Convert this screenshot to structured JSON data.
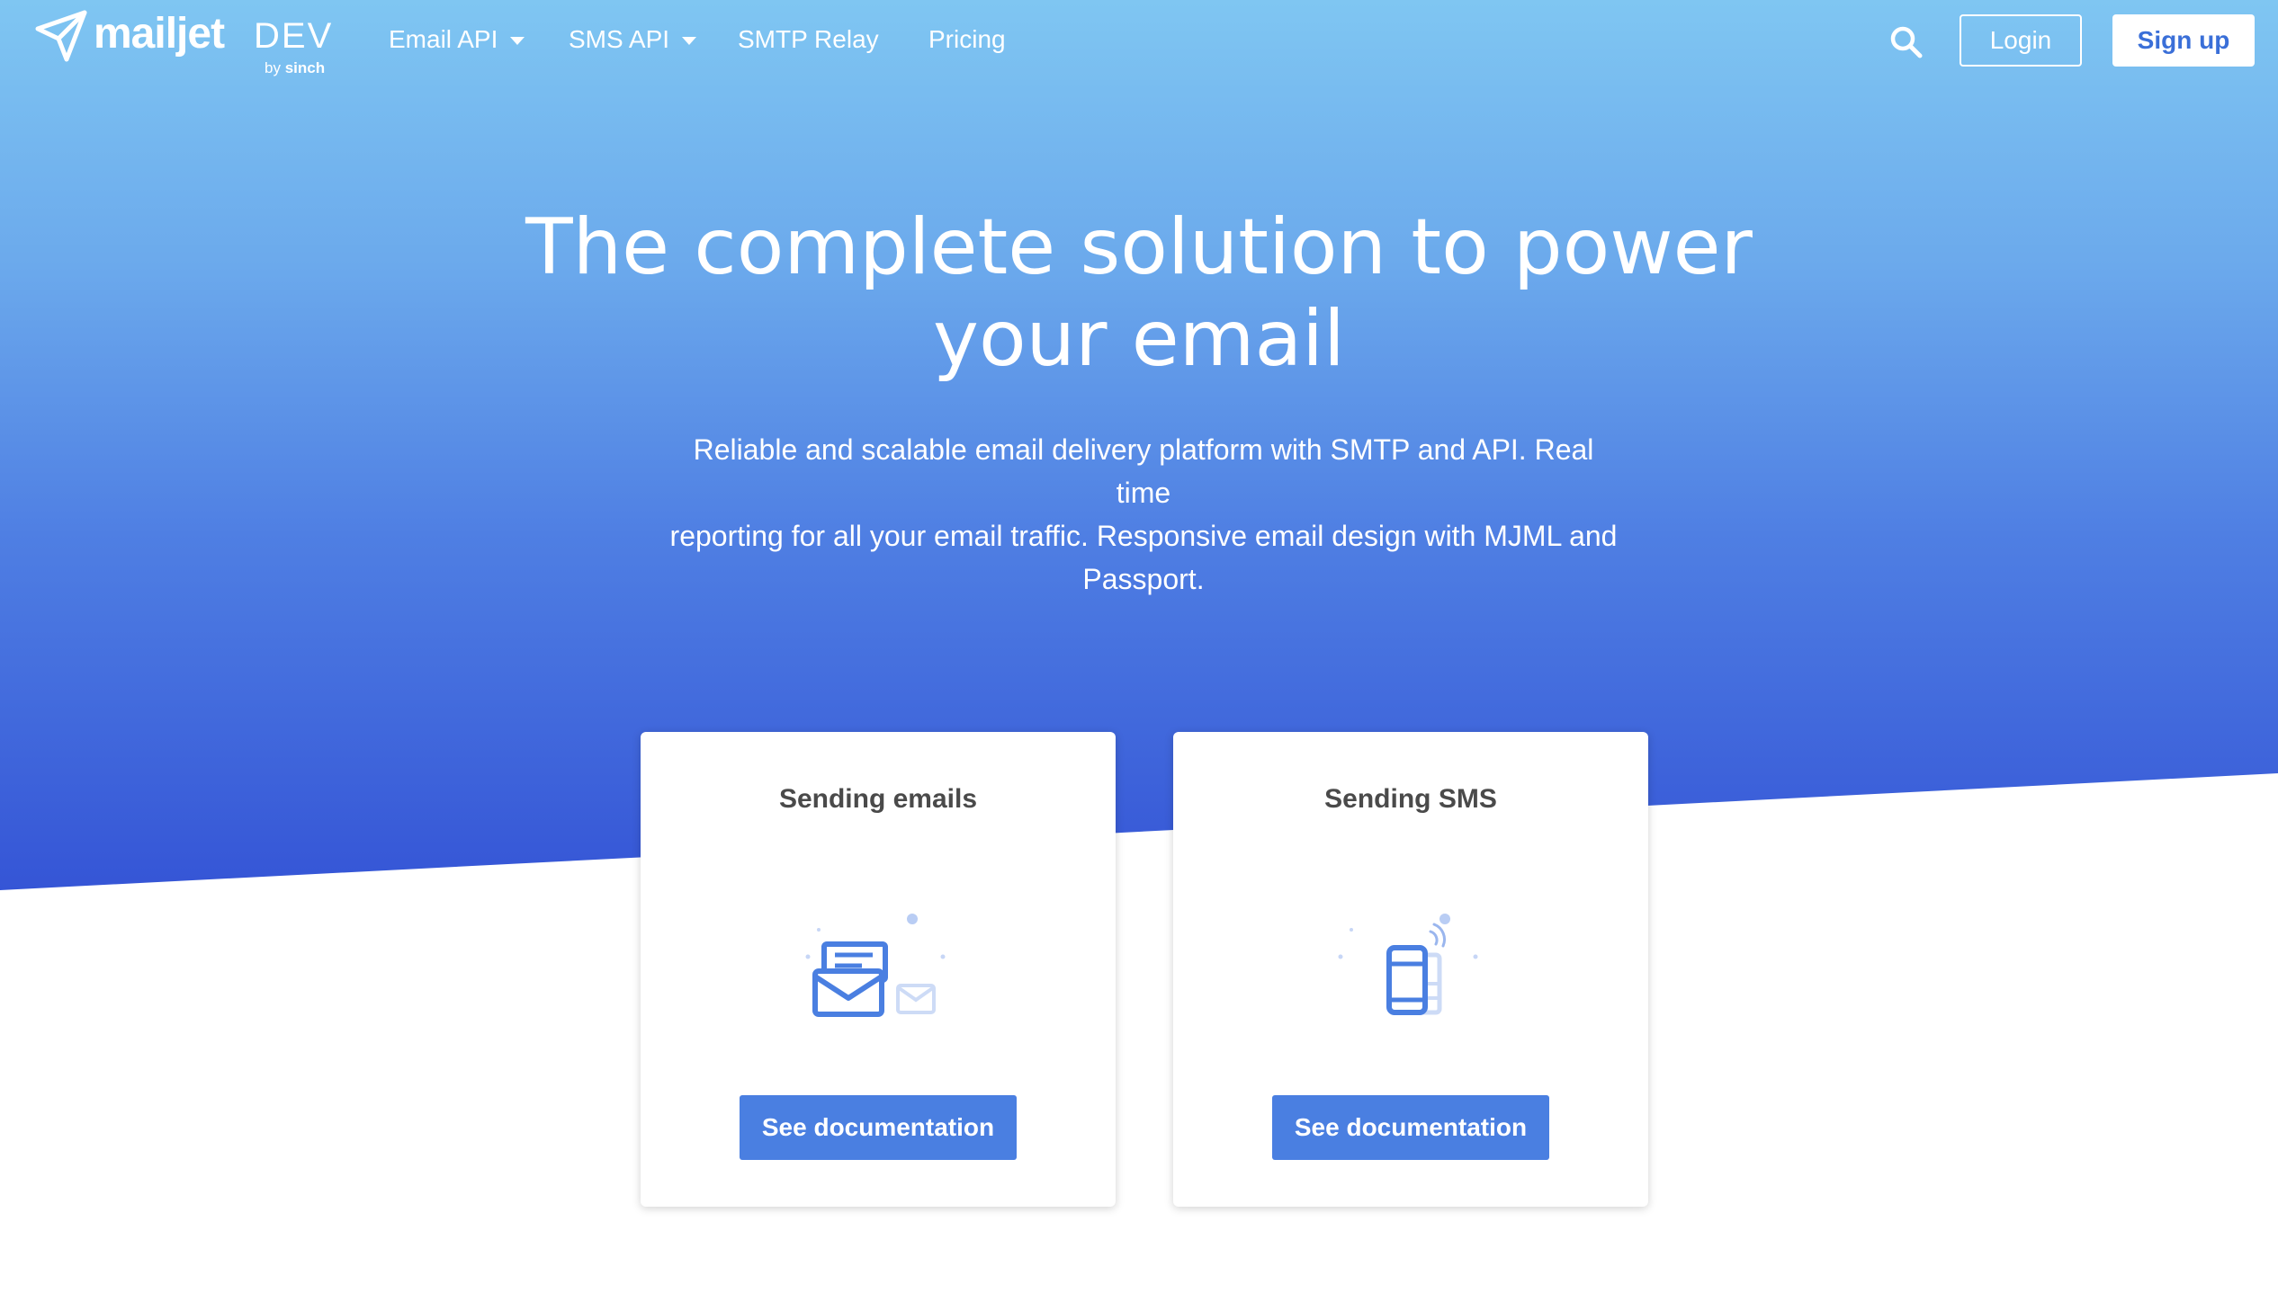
{
  "brand": {
    "name": "mailjet",
    "suffix": "DEV",
    "by_text": "by",
    "by_brand": "sinch"
  },
  "nav": {
    "items": [
      {
        "label": "Email API",
        "has_dropdown": true
      },
      {
        "label": "SMS API",
        "has_dropdown": true
      },
      {
        "label": "SMTP Relay",
        "has_dropdown": false
      },
      {
        "label": "Pricing",
        "has_dropdown": false
      }
    ],
    "login_label": "Login",
    "signup_label": "Sign up",
    "search_icon": "search-icon"
  },
  "hero": {
    "title_line1": "The complete solution to power",
    "title_line2": "your email",
    "subtitle_line1": "Reliable and scalable email delivery platform with SMTP and API. Real time",
    "subtitle_line2": "reporting for all your email traffic. Responsive email design with MJML and",
    "subtitle_line3": "Passport."
  },
  "cards": [
    {
      "title": "Sending emails",
      "icon": "envelope-icon",
      "button_label": "See documentation"
    },
    {
      "title": "Sending SMS",
      "icon": "phone-icon",
      "button_label": "See documentation"
    }
  ],
  "colors": {
    "hero_top": "#7fc6f2",
    "hero_bottom": "#3555d6",
    "accent": "#4a7fe1",
    "card_title": "#4a4a4a",
    "signup_text": "#3a6fd8"
  }
}
